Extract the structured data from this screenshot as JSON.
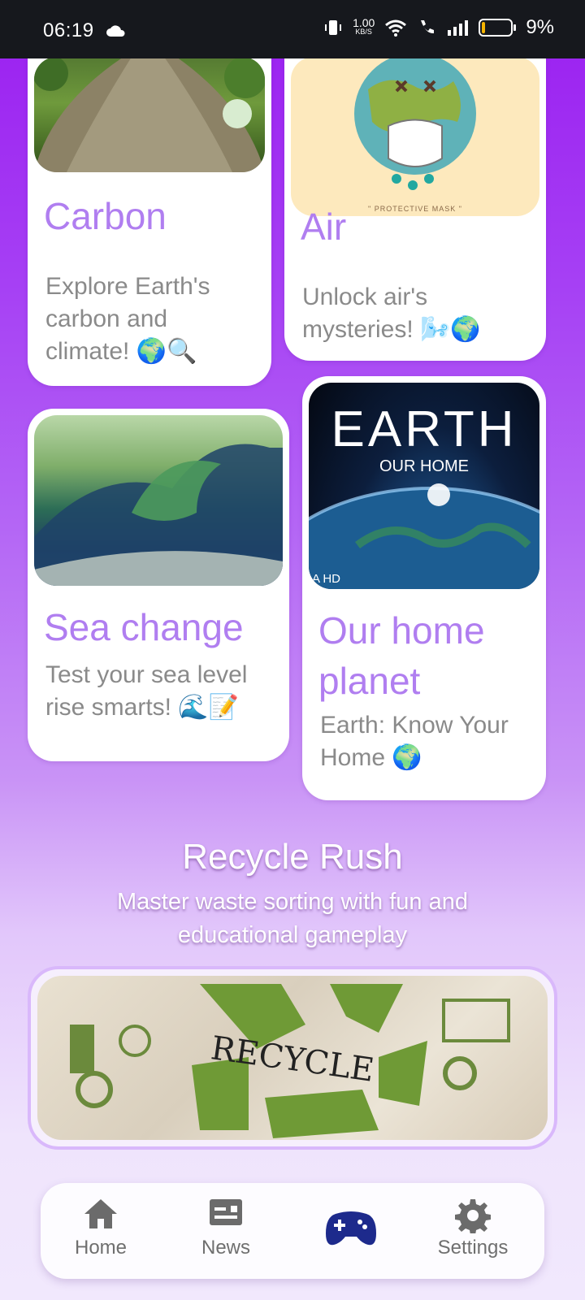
{
  "status_bar": {
    "time": "06:19",
    "net_speed_value": "1.00",
    "net_speed_unit": "KB/S",
    "battery": "9%"
  },
  "cards": [
    {
      "title": "Carbon",
      "description": "Explore Earth's carbon and climate! 🌍🔍"
    },
    {
      "title": "Air",
      "description": "Unlock air's mysteries! 🌬️🌍",
      "image_caption": "\" PROTECTIVE MASK \""
    },
    {
      "title": "Sea change",
      "description": "Test your sea level rise smarts! 🌊📝"
    },
    {
      "title": "Our home planet",
      "description": "Earth: Know Your Home 🌍",
      "image_title": "EARTH",
      "image_subtitle": "OUR HOME",
      "image_badge": "A HD"
    }
  ],
  "section": {
    "title": "Recycle Rush",
    "subtitle": "Master waste sorting with fun and educational gameplay",
    "banner_text": "RECYCLE"
  },
  "nav": {
    "home": "Home",
    "news": "News",
    "settings": "Settings",
    "active": "games"
  },
  "colors": {
    "accent": "#b07ef0",
    "active_nav_icon": "#1d2a8c"
  }
}
